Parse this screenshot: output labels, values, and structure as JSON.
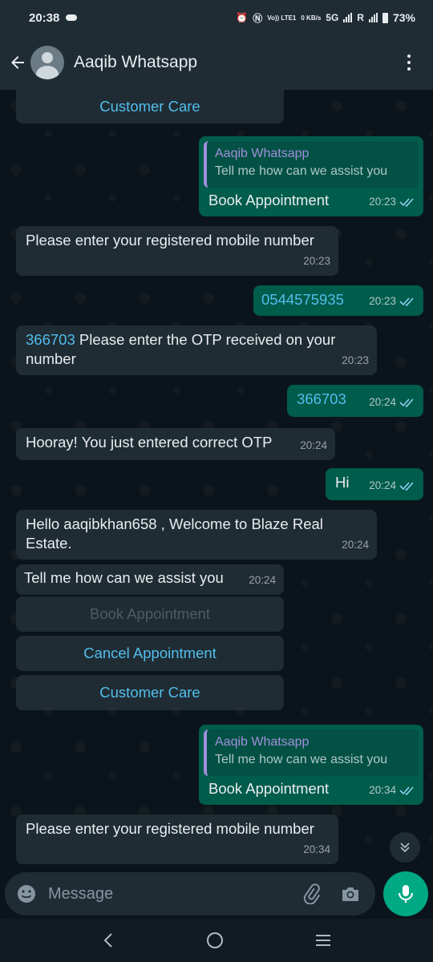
{
  "status": {
    "time": "20:38",
    "indicators": [
      "Vo)) LTE1",
      "0 KB/s",
      "5G",
      "R"
    ],
    "battery": "73%"
  },
  "header": {
    "title": "Aaqib Whatsapp"
  },
  "messages": [
    {
      "text": "Please enter your registered mobile number",
      "time": "20:23"
    },
    {
      "text": "0544575935",
      "time": "20:23"
    },
    {
      "link": "366703",
      "text": " Please enter the OTP received on your number",
      "time": "20:23"
    },
    {
      "text": "366703",
      "time": "20:24"
    },
    {
      "text": "Hooray! You just entered correct OTP",
      "time": "20:24"
    },
    {
      "text": "Hi",
      "time": "20:24"
    },
    {
      "text": "Hello aaqibkhan658 , Welcome to Blaze Real Estate.",
      "time": "20:24"
    },
    {
      "text": "Tell me how can we assist you",
      "time": "20:24"
    },
    {
      "text": "Please enter your registered mobile number",
      "time": "20:34"
    }
  ],
  "replies": [
    {
      "quote_name": "Aaqib Whatsapp",
      "quote_text": "Tell me how can we assist you",
      "text": "Book Appointment",
      "time": "20:23"
    },
    {
      "quote_name": "Aaqib Whatsapp",
      "quote_text": "Tell me how can we assist you",
      "text": "Book Appointment",
      "time": "20:34"
    }
  ],
  "buttons": {
    "top_customer_care": "Customer Care",
    "book": "Book Appointment",
    "cancel": "Cancel Appointment",
    "customer_care": "Customer Care"
  },
  "input": {
    "placeholder": "Message"
  },
  "icons": [
    "back-arrow-icon",
    "avatar-icon",
    "more-vert-icon",
    "emoji-icon",
    "attach-icon",
    "camera-icon",
    "mic-icon",
    "scroll-down-icon",
    "nav-back-icon",
    "nav-home-icon",
    "nav-recents-icon"
  ],
  "colors": {
    "bubble_in": "#1f2c34",
    "bubble_out": "#005c4b",
    "accent": "#00a884",
    "link": "#53bdeb"
  }
}
